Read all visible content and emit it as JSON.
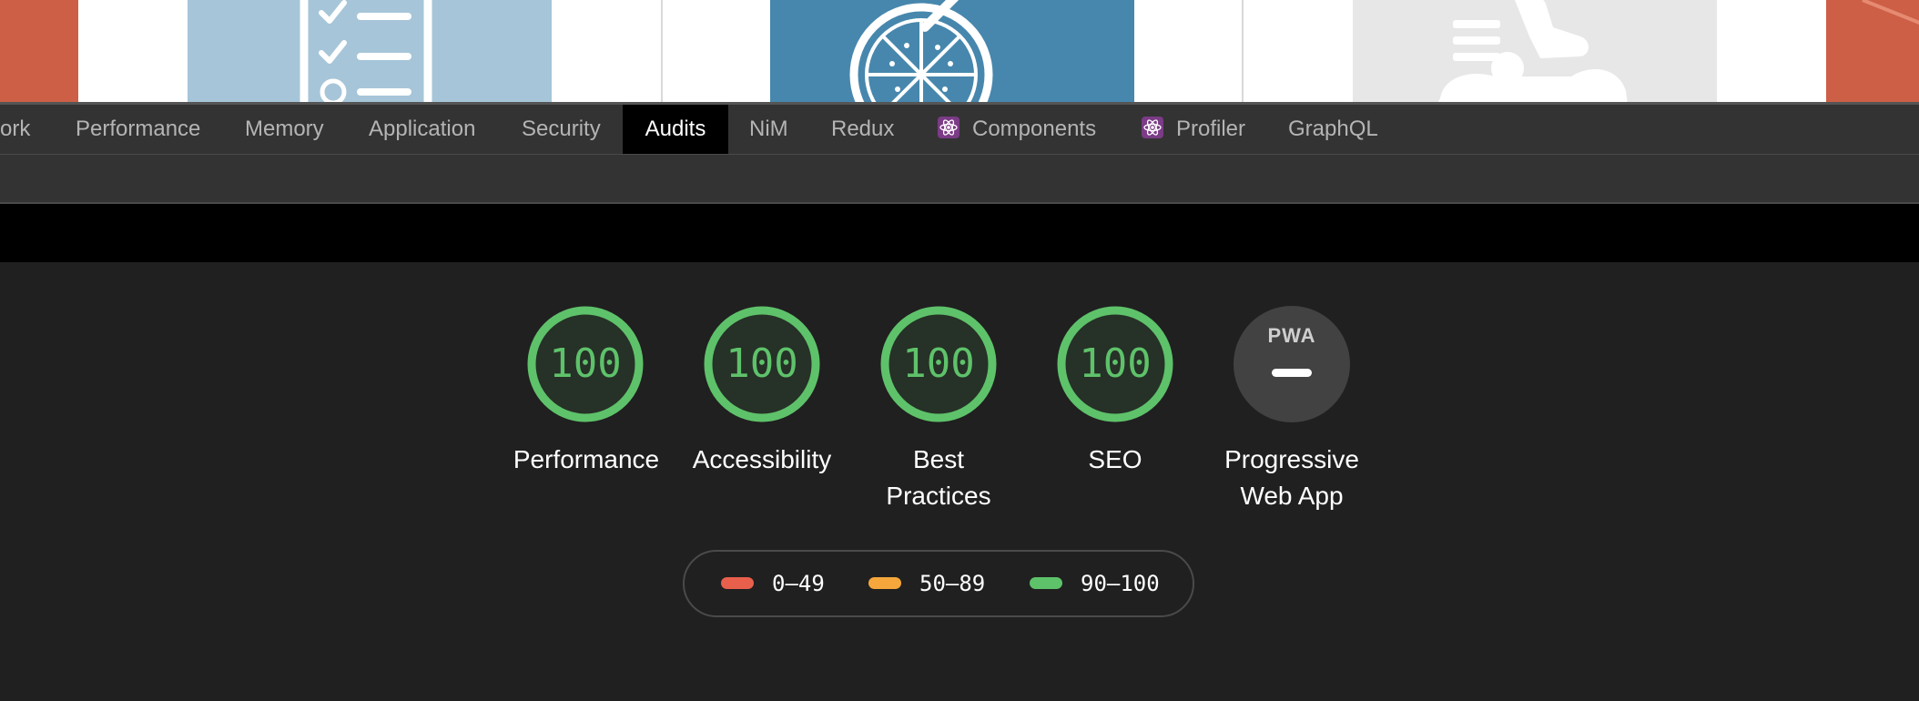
{
  "devtools": {
    "tabs": [
      {
        "label": "ork"
      },
      {
        "label": "Performance"
      },
      {
        "label": "Memory"
      },
      {
        "label": "Application"
      },
      {
        "label": "Security"
      },
      {
        "label": "Audits",
        "active": true
      },
      {
        "label": "NiM"
      },
      {
        "label": "Redux"
      },
      {
        "label": "Components",
        "icon": "react-icon"
      },
      {
        "label": "Profiler",
        "icon": "react-icon"
      },
      {
        "label": "GraphQL"
      }
    ]
  },
  "report": {
    "gauges": [
      {
        "score": "100",
        "label": "Performance"
      },
      {
        "score": "100",
        "label": "Accessibility"
      },
      {
        "score": "100",
        "label": "Best Practices"
      },
      {
        "score": "100",
        "label": "SEO"
      },
      {
        "badge": "PWA",
        "label": "Progressive Web App"
      }
    ],
    "legend": [
      {
        "range": "0–49",
        "color": "#e8604c"
      },
      {
        "range": "50–89",
        "color": "#f5a73b"
      },
      {
        "range": "90–100",
        "color": "#5ec26a"
      }
    ]
  },
  "colors": {
    "pass": "#5ec26a",
    "average": "#f5a73b",
    "fail": "#e8604c",
    "brand_orange": "#cc5f45",
    "tile_light_blue": "#a6c5d8",
    "tile_blue": "#4787ad",
    "tile_gray": "#e7e7e7"
  }
}
